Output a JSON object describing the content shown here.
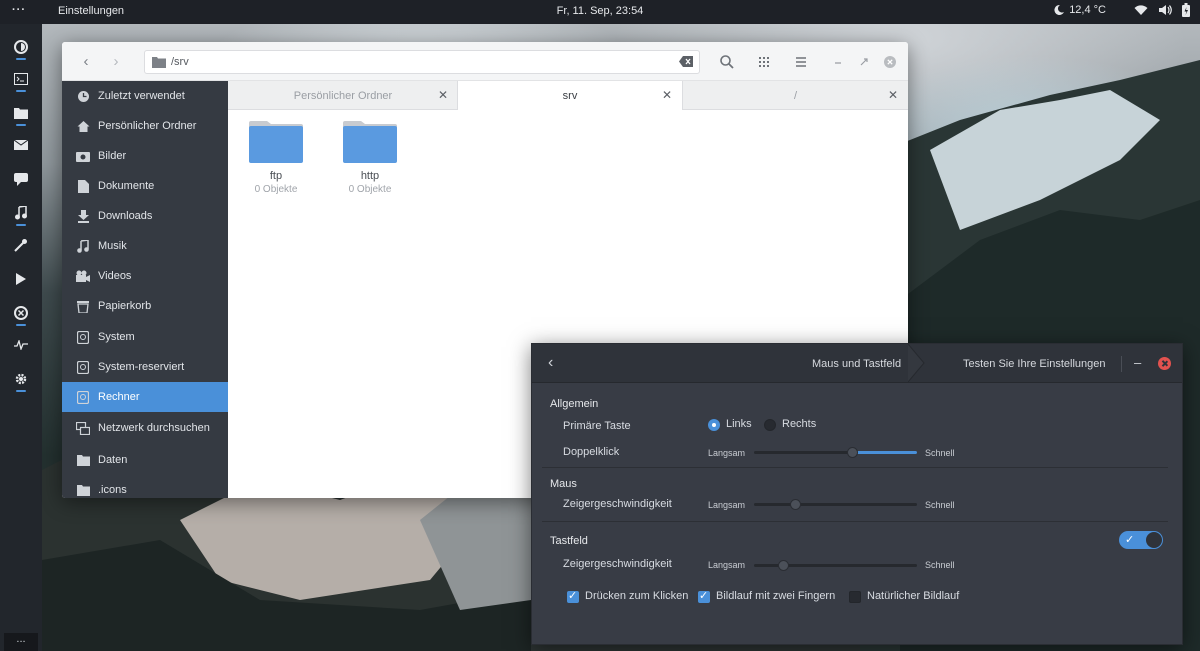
{
  "topbar": {
    "apps_label": "···",
    "app_name": "Einstellungen",
    "clock": "Fr, 11. Sep, 23:54",
    "weather": "12,4 °C"
  },
  "dock": {
    "items": [
      "firefox-icon",
      "terminal-icon",
      "files-icon",
      "mail-icon",
      "chat-icon",
      "music-icon",
      "tweaks-icon",
      "video-icon",
      "help-icon",
      "monitor-icon",
      "settings-icon"
    ],
    "bottom_label": "..."
  },
  "file_manager": {
    "path": "/srv",
    "sidebar": [
      {
        "label": "Zuletzt verwendet",
        "icon": "clock-icon"
      },
      {
        "label": "Persönlicher Ordner",
        "icon": "home-icon"
      },
      {
        "label": "Bilder",
        "icon": "camera-icon"
      },
      {
        "label": "Dokumente",
        "icon": "document-icon"
      },
      {
        "label": "Downloads",
        "icon": "download-icon"
      },
      {
        "label": "Musik",
        "icon": "music-note-icon"
      },
      {
        "label": "Videos",
        "icon": "film-icon"
      },
      {
        "label": "Papierkorb",
        "icon": "trash-icon"
      },
      {
        "label": "System",
        "icon": "drive-icon"
      },
      {
        "label": "System-reserviert",
        "icon": "drive-icon"
      },
      {
        "label": "Rechner",
        "icon": "drive-icon",
        "active": true
      },
      {
        "label": "Netzwerk durchsuchen",
        "icon": "network-icon"
      },
      {
        "label": "Daten",
        "icon": "folder-icon"
      },
      {
        "label": ".icons",
        "icon": "folder-icon"
      }
    ],
    "tabs": [
      {
        "label": "Persönlicher Ordner"
      },
      {
        "label": "srv",
        "active": true
      },
      {
        "label": "/"
      }
    ],
    "items": [
      {
        "name": "ftp",
        "count": "0 Objekte"
      },
      {
        "name": "http",
        "count": "0 Objekte"
      }
    ]
  },
  "settings": {
    "title": "Maus und Tastfeld",
    "test_label": "Testen Sie Ihre Einstellungen",
    "general": {
      "heading": "Allgemein",
      "primary_button_label": "Primäre Taste",
      "left_label": "Links",
      "right_label": "Rechts",
      "primary_selected": "Links",
      "double_click_label": "Doppelklick",
      "double_click_value": 0.6
    },
    "mouse": {
      "heading": "Maus",
      "speed_label": "Zeigergeschwindigkeit",
      "speed_value": 0.25
    },
    "touchpad": {
      "heading": "Tastfeld",
      "enabled": true,
      "speed_label": "Zeigergeschwindigkeit",
      "speed_value": 0.18,
      "tap_to_click_label": "Drücken zum Klicken",
      "tap_to_click": true,
      "two_finger_label": "Bildlauf mit zwei Fingern",
      "two_finger": true,
      "natural_label": "Natürlicher Bildlauf",
      "natural": false
    },
    "slow_label": "Langsam",
    "fast_label": "Schnell"
  },
  "colors": {
    "accent": "#4a90d9",
    "sidebar_bg": "#353a42",
    "settings_bg": "#383c45",
    "close_red": "#e2524f"
  }
}
